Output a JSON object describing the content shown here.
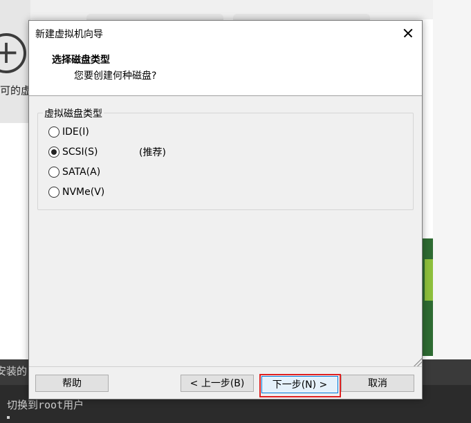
{
  "background": {
    "left_label": "可的虚拟",
    "bottom_label": "安装的",
    "console_line": "切换到root用户"
  },
  "dialog": {
    "title": "新建虚拟机向导",
    "header_title": "选择磁盘类型",
    "header_subtitle": "您要创建何种磁盘?",
    "group_label": "虚拟磁盘类型",
    "options": [
      {
        "label": "IDE(I)",
        "checked": false,
        "note": ""
      },
      {
        "label": "SCSI(S)",
        "checked": true,
        "note": "(推荐)"
      },
      {
        "label": "SATA(A)",
        "checked": false,
        "note": ""
      },
      {
        "label": "NVMe(V)",
        "checked": false,
        "note": ""
      }
    ],
    "buttons": {
      "help": "帮助",
      "back": "< 上一步(B)",
      "next": "下一步(N) >",
      "cancel": "取消"
    }
  },
  "colors": {
    "highlight": "#e02020",
    "focus": "#0078d7"
  }
}
